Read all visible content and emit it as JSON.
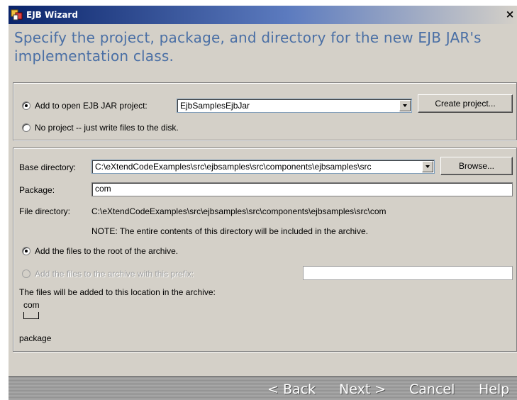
{
  "window": {
    "title": "EJB Wizard",
    "close_glyph": "×",
    "icon": "wizard-icon",
    "header_text": "Specify the project, package, and directory for the new EJB JAR's implementation class."
  },
  "project_group": {
    "add_to_project_label": "Add to open EJB JAR project:",
    "add_to_project_selected": true,
    "project_value": "EjbSamplesEjbJar",
    "create_project_label": "Create project...",
    "no_project_label": "No project -- just write files to the disk.",
    "no_project_selected": false
  },
  "directory_group": {
    "base_dir_label": "Base directory:",
    "base_dir_value": "C:\\eXtendCodeExamples\\src\\ejbsamples\\src\\components\\ejbsamples\\src",
    "browse_label": "Browse...",
    "package_label": "Package:",
    "package_value": "com",
    "file_dir_label": "File directory:",
    "file_dir_value": "C:\\eXtendCodeExamples\\src\\ejbsamples\\src\\components\\ejbsamples\\src\\com",
    "note_text": "NOTE: The entire contents of this directory will be included in the archive.",
    "root_option_label": "Add the files to the root of the archive.",
    "root_option_selected": true,
    "prefix_option_label": "Add the files to the archive with this prefix:",
    "prefix_option_enabled": false,
    "prefix_value": "",
    "location_text": "The files will be added to this location in the archive:",
    "tree_top": "com",
    "tree_bottom": "package"
  },
  "footer": {
    "back_label": "< Back",
    "next_label": "Next >",
    "cancel_label": "Cancel",
    "help_label": "Help"
  },
  "colors": {
    "title_bar": "#0a246a",
    "header_text": "#4a6fa5",
    "dialog_bg": "#d4d0c8",
    "footer_bg": "#9a9a9a"
  }
}
